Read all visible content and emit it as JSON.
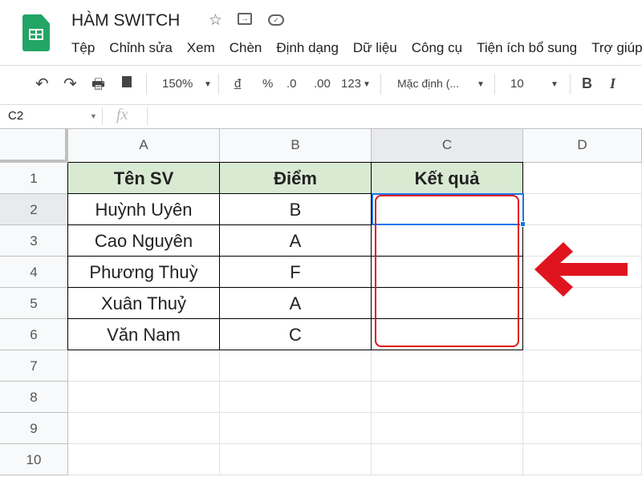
{
  "app": {
    "title": "HÀM SWITCH",
    "icons": [
      "star-icon",
      "move-folder-icon",
      "cloud-saved-icon"
    ]
  },
  "menu": [
    "Tệp",
    "Chỉnh sửa",
    "Xem",
    "Chèn",
    "Định dạng",
    "Dữ liệu",
    "Công cụ",
    "Tiện ích bổ sung",
    "Trợ giúp"
  ],
  "toolbar": {
    "zoom": "150%",
    "currency": "đ",
    "percent": "%",
    "dec_decrease": ".0",
    "dec_increase": ".00",
    "format": "123",
    "font": "Mặc định (...",
    "size": "10",
    "bold": "B",
    "italic": "I"
  },
  "formula_bar": {
    "name_box": "C2",
    "fx": "fx",
    "value": ""
  },
  "columns": [
    "A",
    "B",
    "C",
    "D"
  ],
  "rows": [
    "1",
    "2",
    "3",
    "4",
    "5",
    "6",
    "7",
    "8",
    "9",
    "10"
  ],
  "table": {
    "headers": [
      "Tên SV",
      "Điểm",
      "Kết quả"
    ],
    "rows": [
      [
        "Huỳnh Uyên",
        "B",
        ""
      ],
      [
        "Cao Nguyên",
        "A",
        ""
      ],
      [
        "Phương Thuỳ",
        "F",
        ""
      ],
      [
        "Xuân Thuỷ",
        "A",
        ""
      ],
      [
        "Văn Nam",
        "C",
        ""
      ]
    ]
  },
  "selected_cell": "C2",
  "colors": {
    "header_fill": "#d9ead3",
    "annotation": "#e0141e",
    "selection": "#1a73e8",
    "logo": "#23a566"
  }
}
